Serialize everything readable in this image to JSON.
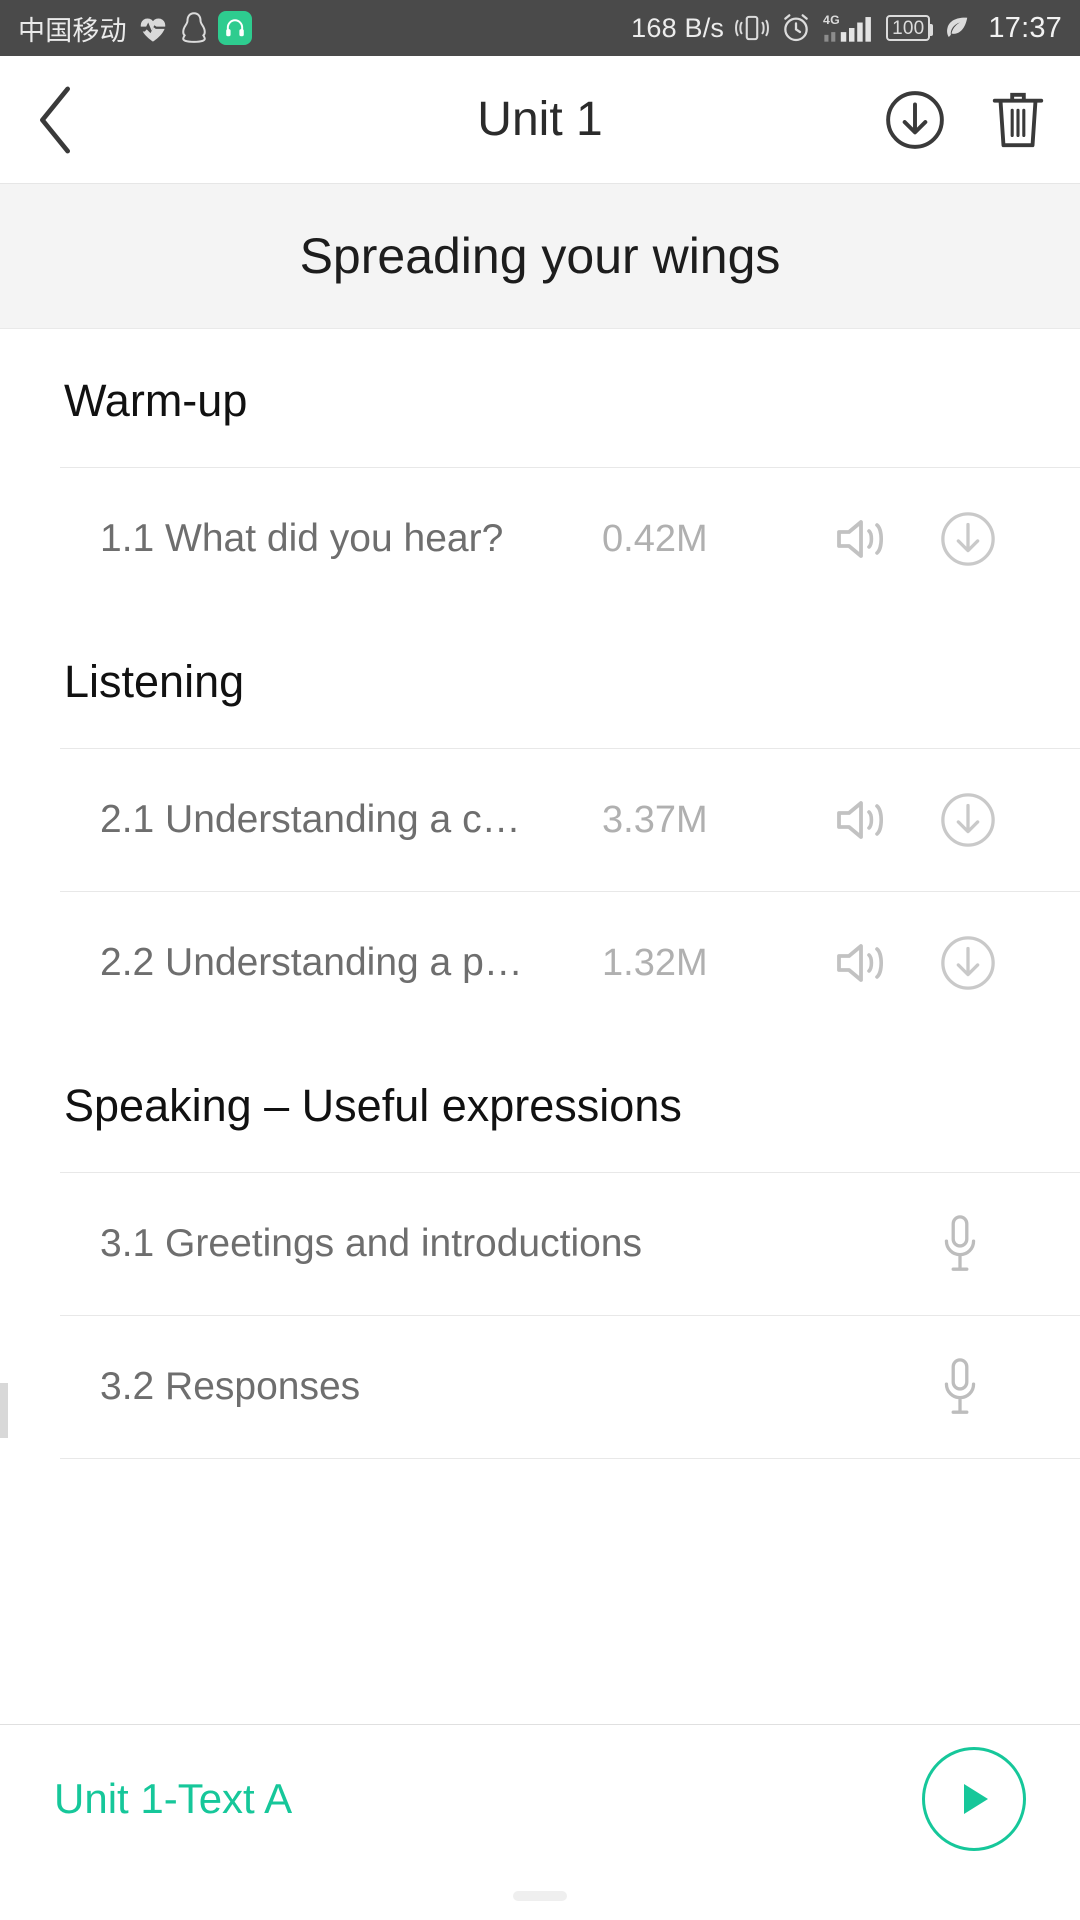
{
  "status_bar": {
    "carrier": "中国移动",
    "icons_left": [
      "heart-rate-icon",
      "qq-penguin-icon",
      "headphone-app-icon"
    ],
    "network_speed": "168 B/s",
    "icons_right": [
      "vibrate-icon",
      "alarm-clock-icon",
      "signal-4g-icon"
    ],
    "network_type": "4G",
    "battery_level": "100",
    "eco_icon": "leaf-icon",
    "time": "17:37",
    "background": "#4a4a4a"
  },
  "header": {
    "back_icon": "chevron-left-icon",
    "title": "Unit 1",
    "download_icon": "download-circle-icon",
    "delete_icon": "trash-icon"
  },
  "banner": {
    "title": "Spreading your wings"
  },
  "sections": [
    {
      "title": "Warm-up",
      "rows": [
        {
          "label": "1.1 What did you hear?",
          "size": "0.42M",
          "actions": [
            "speaker-icon",
            "download-circle-icon"
          ],
          "type": "audio"
        }
      ]
    },
    {
      "title": "Listening",
      "rows": [
        {
          "label": "2.1 Understanding a c…",
          "size": "3.37M",
          "actions": [
            "speaker-icon",
            "download-circle-icon"
          ],
          "type": "audio"
        },
        {
          "label": "2.2 Understanding a p…",
          "size": "1.32M",
          "actions": [
            "speaker-icon",
            "download-circle-icon"
          ],
          "type": "audio"
        }
      ]
    },
    {
      "title": "Speaking – Useful expressions",
      "rows": [
        {
          "label": "3.1 Greetings and introductions",
          "size": "",
          "actions": [
            "microphone-icon"
          ],
          "type": "record"
        },
        {
          "label": "3.2 Responses",
          "size": "",
          "actions": [
            "microphone-icon"
          ],
          "type": "record"
        }
      ]
    }
  ],
  "player": {
    "title": "Unit 1-Text A",
    "play_icon": "play-icon",
    "accent_color": "#16c79a"
  }
}
